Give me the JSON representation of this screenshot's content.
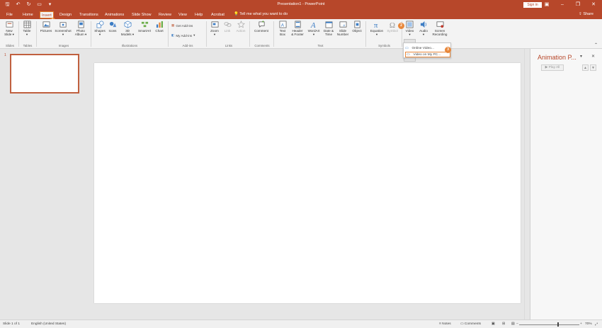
{
  "title_bar": {
    "document_title": "Presentation1 - PowerPoint",
    "sign_in_label": "Sign in",
    "qat_icons": [
      "save-icon",
      "undo-icon",
      "redo-icon",
      "start-from-beginning-icon",
      "customize-qat-icon"
    ],
    "window_icons": [
      "ribbon-display-icon",
      "minimize-icon",
      "restore-icon",
      "close-icon"
    ]
  },
  "tabs": [
    {
      "label": "File"
    },
    {
      "label": "Home"
    },
    {
      "label": "Insert",
      "active": true
    },
    {
      "label": "Design"
    },
    {
      "label": "Transitions"
    },
    {
      "label": "Animations"
    },
    {
      "label": "Slide Show"
    },
    {
      "label": "Review"
    },
    {
      "label": "View"
    },
    {
      "label": "Help"
    },
    {
      "label": "Acrobat"
    }
  ],
  "tell_me": "Tell me what you want to do",
  "share_label": "Share",
  "step_badges": [
    "1",
    "2",
    "3"
  ],
  "ribbon": {
    "groups": [
      {
        "label": "Slides"
      },
      {
        "label": "Tables"
      },
      {
        "label": "Images"
      },
      {
        "label": "Illustrations"
      },
      {
        "label": "Add-ins"
      },
      {
        "label": "Links"
      },
      {
        "label": "Comments"
      },
      {
        "label": "Text"
      },
      {
        "label": "Symbols"
      },
      {
        "label": ""
      }
    ],
    "buttons": {
      "new_slide": [
        "New",
        "Slide ▾"
      ],
      "table": [
        "Table",
        "▾"
      ],
      "pictures": [
        "Pictures",
        ""
      ],
      "screenshot": [
        "Screenshot",
        "▾"
      ],
      "photo_album": [
        "Photo",
        "Album ▾"
      ],
      "shapes": [
        "Shapes",
        "▾"
      ],
      "icons": [
        "Icons",
        ""
      ],
      "models_3d": [
        "3D",
        "Models ▾"
      ],
      "smartart": [
        "SmartArt",
        ""
      ],
      "chart": [
        "Chart",
        ""
      ],
      "get_addins": "Get Add-ins",
      "my_addins": "My Add-ins",
      "zoom": [
        "Zoom",
        "▾"
      ],
      "link": [
        "Link",
        ""
      ],
      "action": [
        "Action",
        ""
      ],
      "comment": [
        "Comment",
        ""
      ],
      "text_box": [
        "Text",
        "Box"
      ],
      "header_footer": [
        "Header",
        "& Footer"
      ],
      "wordart": [
        "WordArt",
        "▾"
      ],
      "date_time": [
        "Date &",
        "Time"
      ],
      "slide_number": [
        "Slide",
        "Number"
      ],
      "object": [
        "Object",
        ""
      ],
      "equation": [
        "Equation",
        "▾"
      ],
      "symbol": [
        "Symbol",
        ""
      ],
      "video": [
        "Video",
        "▾"
      ],
      "audio": [
        "Audio",
        "▾"
      ],
      "screen_recording": [
        "Screen",
        "Recording"
      ]
    }
  },
  "video_menu": {
    "items": [
      "Online Video...",
      "Video on My PC..."
    ]
  },
  "thumbnail_pane": {
    "slide_number": "1"
  },
  "animation_pane": {
    "title": "Animation P...",
    "play_all": "▶ Play All",
    "move_up": "▲",
    "move_down": "▼"
  },
  "status_bar": {
    "slide_info": "Slide 1 of 1",
    "language": "English (United States)",
    "notes": "Notes",
    "comments": "Comments",
    "zoom": "70%"
  }
}
